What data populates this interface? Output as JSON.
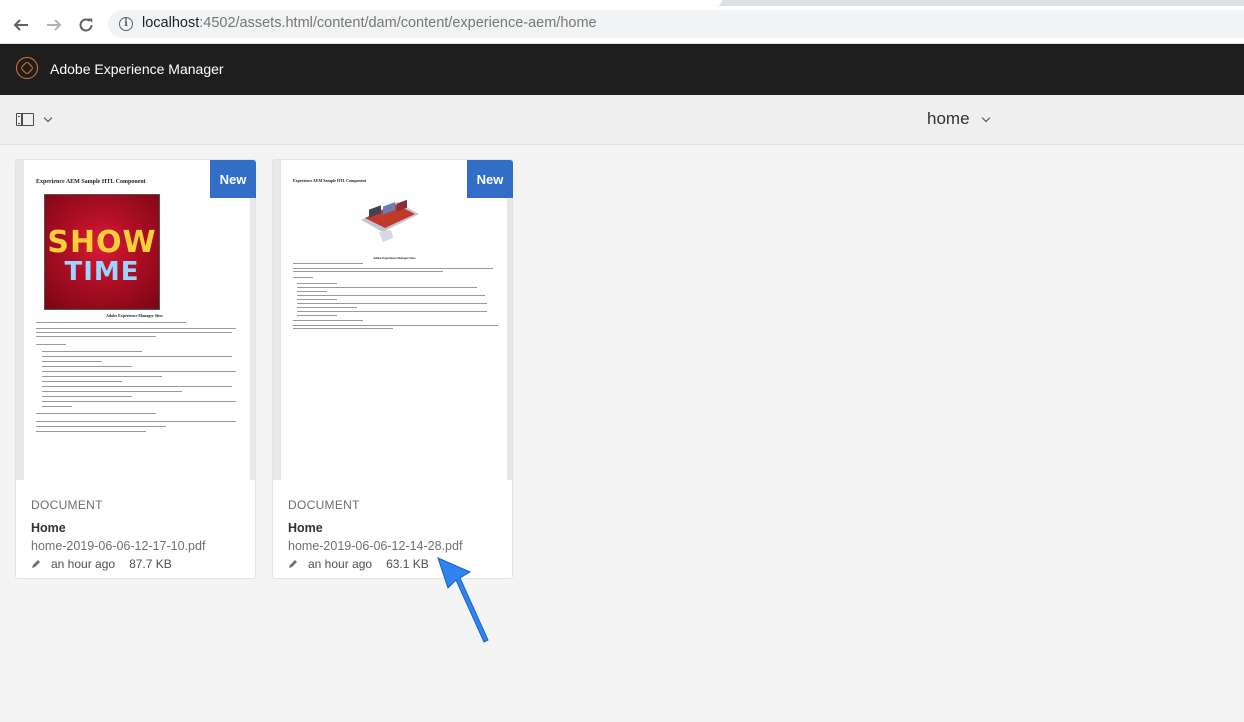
{
  "browser": {
    "url_host": "localhost",
    "url_rest": ":4502/assets.html/content/dam/content/experience-aem/home",
    "back_icon": "arrow-left-icon",
    "forward_icon": "arrow-right-icon",
    "reload_icon": "reload-icon",
    "info_icon": "info-icon"
  },
  "header": {
    "product_name": "Adobe Experience Manager",
    "logo_icon": "aem-logo-icon"
  },
  "actionbar": {
    "rail_toggle_icon": "rail-toggle-icon",
    "folder_title": "home"
  },
  "cards": [
    {
      "badge": "New",
      "type": "DOCUMENT",
      "title": "Home",
      "filename": "home-2019-06-06-12-17-10.pdf",
      "modified": "an hour ago",
      "size": "87.7 KB",
      "preview_title": "Experience AEM Sample HTL Component",
      "preview_image_text_1": "SHOW",
      "preview_image_text_2": "TIME",
      "preview_caption": "Adobe Experience Manager Sites"
    },
    {
      "badge": "New",
      "type": "DOCUMENT",
      "title": "Home",
      "filename": "home-2019-06-06-12-14-28.pdf",
      "modified": "an hour ago",
      "size": "63.1 KB",
      "preview_title": "Experience AEM Sample HTL Component",
      "preview_caption": "Adobe Experience Manager Sites"
    }
  ],
  "colors": {
    "header_bg": "#1e1e1e",
    "badge": "#326ec8",
    "pointer_arrow": "#2f84f0"
  }
}
